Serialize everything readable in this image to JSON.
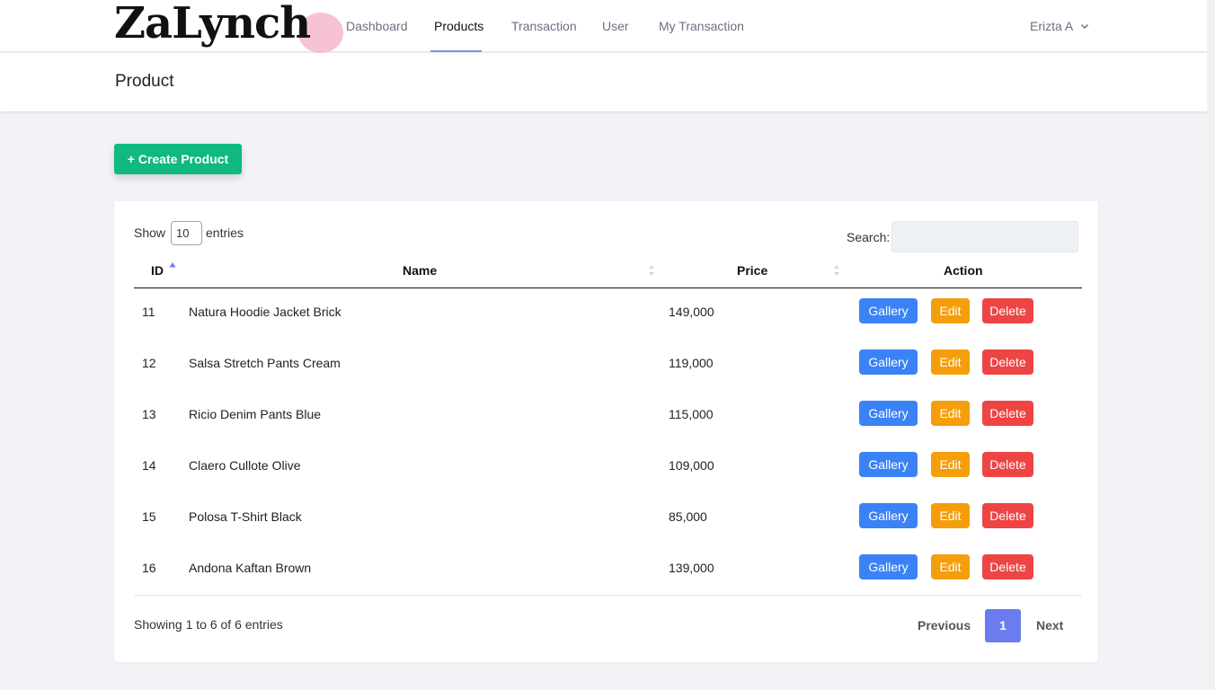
{
  "app": {
    "logo_text": "ZaLynch"
  },
  "nav": {
    "items": [
      {
        "label": "Dashboard"
      },
      {
        "label": "Products",
        "active": true
      },
      {
        "label": "Transaction"
      },
      {
        "label": "User"
      },
      {
        "label": "My Transaction"
      }
    ],
    "user_name": "Erizta A"
  },
  "header": {
    "title": "Product"
  },
  "actions": {
    "create_label": "+ Create Product"
  },
  "table": {
    "length_show": "Show",
    "length_value": "10",
    "length_entries": "entries",
    "search_label": "Search:",
    "search_value": "",
    "columns": [
      "ID",
      "Name",
      "Price",
      "Action"
    ],
    "sorted_column": "ID",
    "rows": [
      {
        "id": "11",
        "name": "Natura Hoodie Jacket Brick",
        "price": "149,000"
      },
      {
        "id": "12",
        "name": "Salsa Stretch Pants Cream",
        "price": "119,000"
      },
      {
        "id": "13",
        "name": "Ricio Denim Pants Blue",
        "price": "115,000"
      },
      {
        "id": "14",
        "name": "Claero Cullote Olive",
        "price": "109,000"
      },
      {
        "id": "15",
        "name": "Polosa T-Shirt Black",
        "price": "85,000"
      },
      {
        "id": "16",
        "name": "Andona Kaftan Brown",
        "price": "139,000"
      }
    ],
    "row_actions": {
      "gallery": "Gallery",
      "edit": "Edit",
      "delete": "Delete"
    },
    "info": "Showing 1 to 6 of 6 entries",
    "pagination": {
      "previous": "Previous",
      "current_page": "1",
      "next": "Next"
    }
  },
  "colors": {
    "primary_green": "#10b981",
    "gallery_blue": "#3b82f6",
    "edit_amber": "#f59e0b",
    "delete_red": "#ef4444",
    "page_active": "#6b7cf0",
    "nav_underline": "#818cf8"
  }
}
